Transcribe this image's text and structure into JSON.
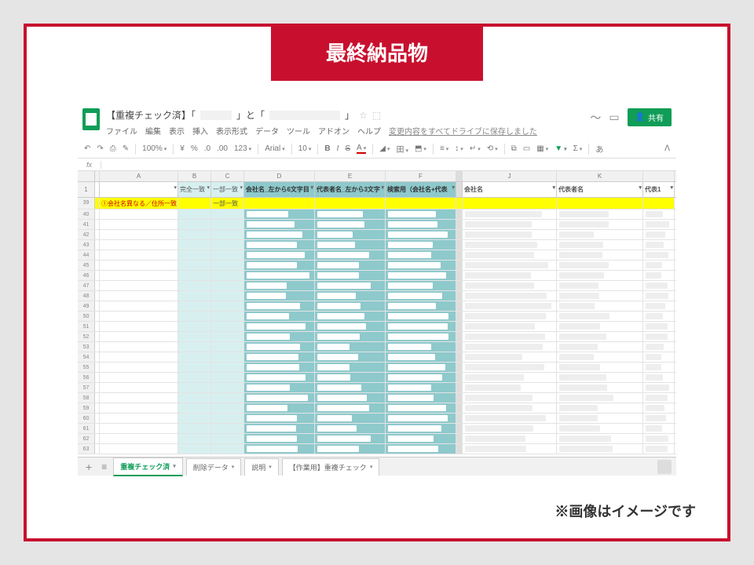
{
  "frame": {
    "title": "最終納品物",
    "footnote": "※画像はイメージです"
  },
  "gsheets": {
    "doc_title_prefix": "【重複チェック済】「",
    "doc_title_mid": "」と「",
    "doc_title_suffix": "」",
    "star_icon": "☆",
    "folder_icon": "⬚",
    "menu": {
      "file": "ファイル",
      "edit": "編集",
      "view": "表示",
      "insert": "挿入",
      "format": "表示形式",
      "data": "データ",
      "tools": "ツール",
      "addons": "アドオン",
      "help": "ヘルプ",
      "save_msg": "変更内容をすべてドライブに保存しました"
    },
    "share_label": "共有",
    "toolbar": {
      "zoom": "100%",
      "currency": "¥",
      "percent": "%",
      "dec_dec": ".0",
      "dec_inc": ".00",
      "format123": "123",
      "font": "Arial",
      "size": "10"
    },
    "fx_label": "fx",
    "columns": [
      "A",
      "B",
      "C",
      "D",
      "E",
      "F",
      "J",
      "K"
    ],
    "filter_headers": {
      "row": "1",
      "A": "",
      "B": "完全一致",
      "C": "一部一致",
      "D": "会社名_左から6文字目",
      "E": "代表者名_左から3文字",
      "F": "検索用（会社名+代表",
      "J": "会社名",
      "K": "代表者名",
      "L": "代表1"
    },
    "first_data_row": {
      "num": "39",
      "A": "①会社名異なる／住所一致",
      "C": "一部一致"
    },
    "row_numbers": [
      "40",
      "41",
      "42",
      "43",
      "44",
      "45",
      "46",
      "47",
      "48",
      "49",
      "50",
      "51",
      "52",
      "53",
      "54",
      "55",
      "56",
      "57",
      "58",
      "59",
      "60",
      "61",
      "62",
      "63"
    ],
    "tabs": {
      "t1": "重複チェック済",
      "t2": "削除データ",
      "t3": "説明",
      "t4": "【作業用】重複チェック"
    }
  }
}
